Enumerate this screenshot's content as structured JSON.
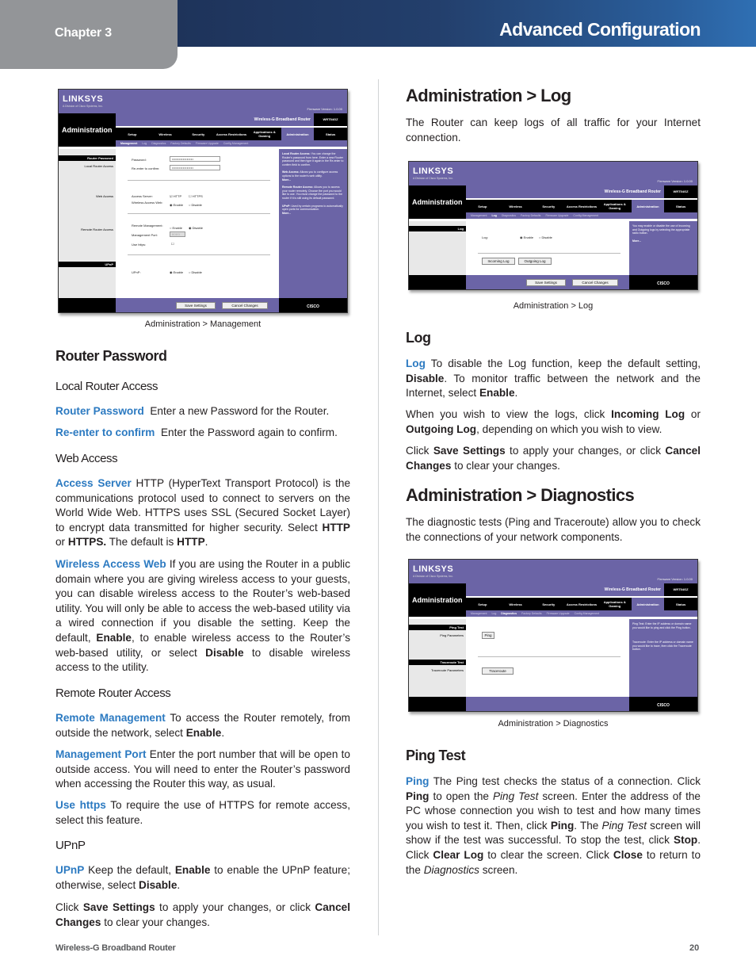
{
  "header": {
    "chapter": "Chapter 3",
    "title": "Advanced Configuration"
  },
  "router_ui": {
    "logo": "LINKSYS",
    "logo_sub": "A Division of Cisco Systems, Inc.",
    "firmware": "Firmware Version: 1.0.00",
    "product": "Wireless-G Broadband Router",
    "model": "WRT54GZ",
    "section": "Administration",
    "tabs": [
      "Setup",
      "Wireless",
      "Security",
      "Access Restrictions",
      "Applications & Gaming",
      "Administration",
      "Status"
    ],
    "subtabs": [
      "Management",
      "Log",
      "Diagnostics",
      "Factory Defaults",
      "Firmware Upgrade",
      "Config Management"
    ],
    "save_button": "Save Settings",
    "cancel_button": "Cancel Changes",
    "cisco": "CISCO",
    "management": {
      "left_labels": [
        "Router Password",
        "Local Router Access",
        "Web Access",
        "Remote Router Access",
        "UPnP"
      ],
      "password_label": "Password:",
      "password_value": "••••••••••••••••",
      "reenter_label": "Re-enter to confirm:",
      "reenter_value": "••••••••••••••••",
      "access_server_label": "Access Server:",
      "http": "HTTP",
      "https": "HTTPS",
      "wireless_access_label": "Wireless Access Web:",
      "enable": "Enable",
      "disable": "Disable",
      "remote_mgmt_label": "Remote Management:",
      "mgmt_port_label": "Management Port:",
      "mgmt_port_value": "8080",
      "use_https_label": "Use https:",
      "upnp_label": "UPnP:",
      "help": [
        {
          "title": "Local Router Access:",
          "text": "You can change the Router's password from here. Enter a new Router password and then type it again in the Re-enter to confirm field to confirm."
        },
        {
          "title": "Web Access:",
          "text": "Allows you to configure access options to the router's web utility."
        },
        {
          "title": "",
          "text": "More..."
        },
        {
          "title": "Remote Router Access:",
          "text": "Allows you to access your router remotely. Choose the port you would like to use. You must change the password to the router if it is still using its default password."
        },
        {
          "title": "UPnP:",
          "text": "Used by certain programs to automatically open ports for communication."
        },
        {
          "title": "",
          "text": "More..."
        }
      ]
    },
    "log": {
      "left_labels": [
        "Log"
      ],
      "log_label": "Log:",
      "enable": "Enable",
      "disable": "Disable",
      "incoming": "Incoming Log",
      "outgoing": "Outgoing Log",
      "help": "You may enable or disable the use of Incoming and Outgoing logs by selecting the appropriate radio button.",
      "more": "More..."
    },
    "diagnostics": {
      "left_labels": [
        "Ping Test",
        "Ping Parameters",
        "Traceroute Test",
        "Traceroute Parameters"
      ],
      "ping_button": "Ping",
      "traceroute_button": "Traceroute",
      "help_ping": "Ping Test: Enter the IP address or domain name you would like to ping and click the Ping button.",
      "help_trace": "Traceroute: Enter the IP address or domain name you would like to trace, then click the Traceroute button."
    }
  },
  "left": {
    "caption": "Administration > Management",
    "h_router_password": "Router Password",
    "h_local": "Local Router Access",
    "p_router_password": {
      "term": "Router Password",
      "text": "Enter a new Password for the Router."
    },
    "p_reenter": {
      "term": "Re-enter to confirm",
      "text": "Enter the Password again to confirm."
    },
    "h_web": "Web Access",
    "p_access_server": {
      "term": "Access Server",
      "t1": " HTTP (HyperText Transport Protocol) is the communications protocol used to connect to servers on the World Wide Web. HTTPS uses SSL (Secured Socket Layer) to encrypt data transmitted for higher security. Select ",
      "b1": "HTTP",
      "t2": " or ",
      "b2": "HTTPS.",
      "t3": " The default is ",
      "b3": "HTTP",
      "t4": "."
    },
    "p_wireless_web": {
      "term": "Wireless Access Web",
      "t1": " If you are using the Router in a public domain where you are giving wireless access to your guests, you can disable wireless access to the Router’s web-based utility. You will only be able to access the web-based utility via a wired connection if you disable the setting. Keep the default, ",
      "b1": "Enable",
      "t2": ", to enable wireless access to the Router’s web-based utility, or select ",
      "b2": "Disable",
      "t3": " to disable wireless access to the utility."
    },
    "h_remote": "Remote Router Access",
    "p_remote_mgmt": {
      "term": "Remote Management",
      "t1": " To access the Router remotely, from outside the network, select ",
      "b1": "Enable",
      "t2": "."
    },
    "p_mgmt_port": {
      "term": "Management Port",
      "t1": " Enter the port number that will be open to outside access. You will need to enter the Router’s password when accessing the Router this way, as usual."
    },
    "p_use_https": {
      "term": "Use https",
      "t1": " To require the use of HTTPS for remote access, select this feature."
    },
    "h_upnp": "UPnP",
    "p_upnp": {
      "term": "UPnP",
      "t1": " Keep the default, ",
      "b1": "Enable",
      "t2": " to enable the UPnP feature; otherwise, select ",
      "b2": "Disable",
      "t3": "."
    },
    "p_save": {
      "t0": "Click ",
      "b1": "Save Settings",
      "t1": " to apply your changes, or click ",
      "b2": "Cancel Changes",
      "t2": " to clear your changes."
    }
  },
  "right": {
    "h_admin_log": "Administration > Log",
    "p_intro_log": "The Router can keep logs of all traffic for your Internet connection.",
    "caption_log": "Administration > Log",
    "h_log": "Log",
    "p_log": {
      "term": "Log",
      "t1": " To disable the Log function, keep the default setting, ",
      "b1": "Disable",
      "t2": ". To monitor traffic between the network and the Internet, select ",
      "b2": "Enable",
      "t3": "."
    },
    "p_view": {
      "t0": "When you wish to view the logs, click ",
      "b1": "Incoming Log",
      "t1": " or ",
      "b2": "Outgoing Log",
      "t2": ", depending on which you wish to view."
    },
    "p_save": {
      "t0": "Click ",
      "b1": "Save Settings",
      "t1": " to apply your changes, or click ",
      "b2": "Cancel Changes",
      "t2": " to clear your changes."
    },
    "h_admin_diag": "Administration > Diagnostics",
    "p_intro_diag": "The diagnostic tests (Ping and Traceroute) allow you to check the connections of your network components.",
    "caption_diag": "Administration > Diagnostics",
    "h_ping": "Ping Test",
    "p_ping": {
      "term": "Ping",
      "t1": " The Ping test checks the status of a connection. Click ",
      "b1": "Ping",
      "t2": " to open the ",
      "i1": "Ping Test",
      "t3": " screen. Enter the address of the PC whose connection you wish to test and how many times you wish to test it. Then, click ",
      "b2": "Ping",
      "t4": ". The ",
      "i2": "Ping Test",
      "t5": " screen will show if the test was successful. To stop the test, click ",
      "b3": "Stop",
      "t6": ". Click ",
      "b4": "Clear Log",
      "t7": " to clear the screen. Click ",
      "b5": "Close",
      "t8": " to return to the ",
      "i3": "Diagnostics",
      "t9": " screen."
    }
  },
  "footer": {
    "product": "Wireless-G Broadband Router",
    "page": "20"
  }
}
